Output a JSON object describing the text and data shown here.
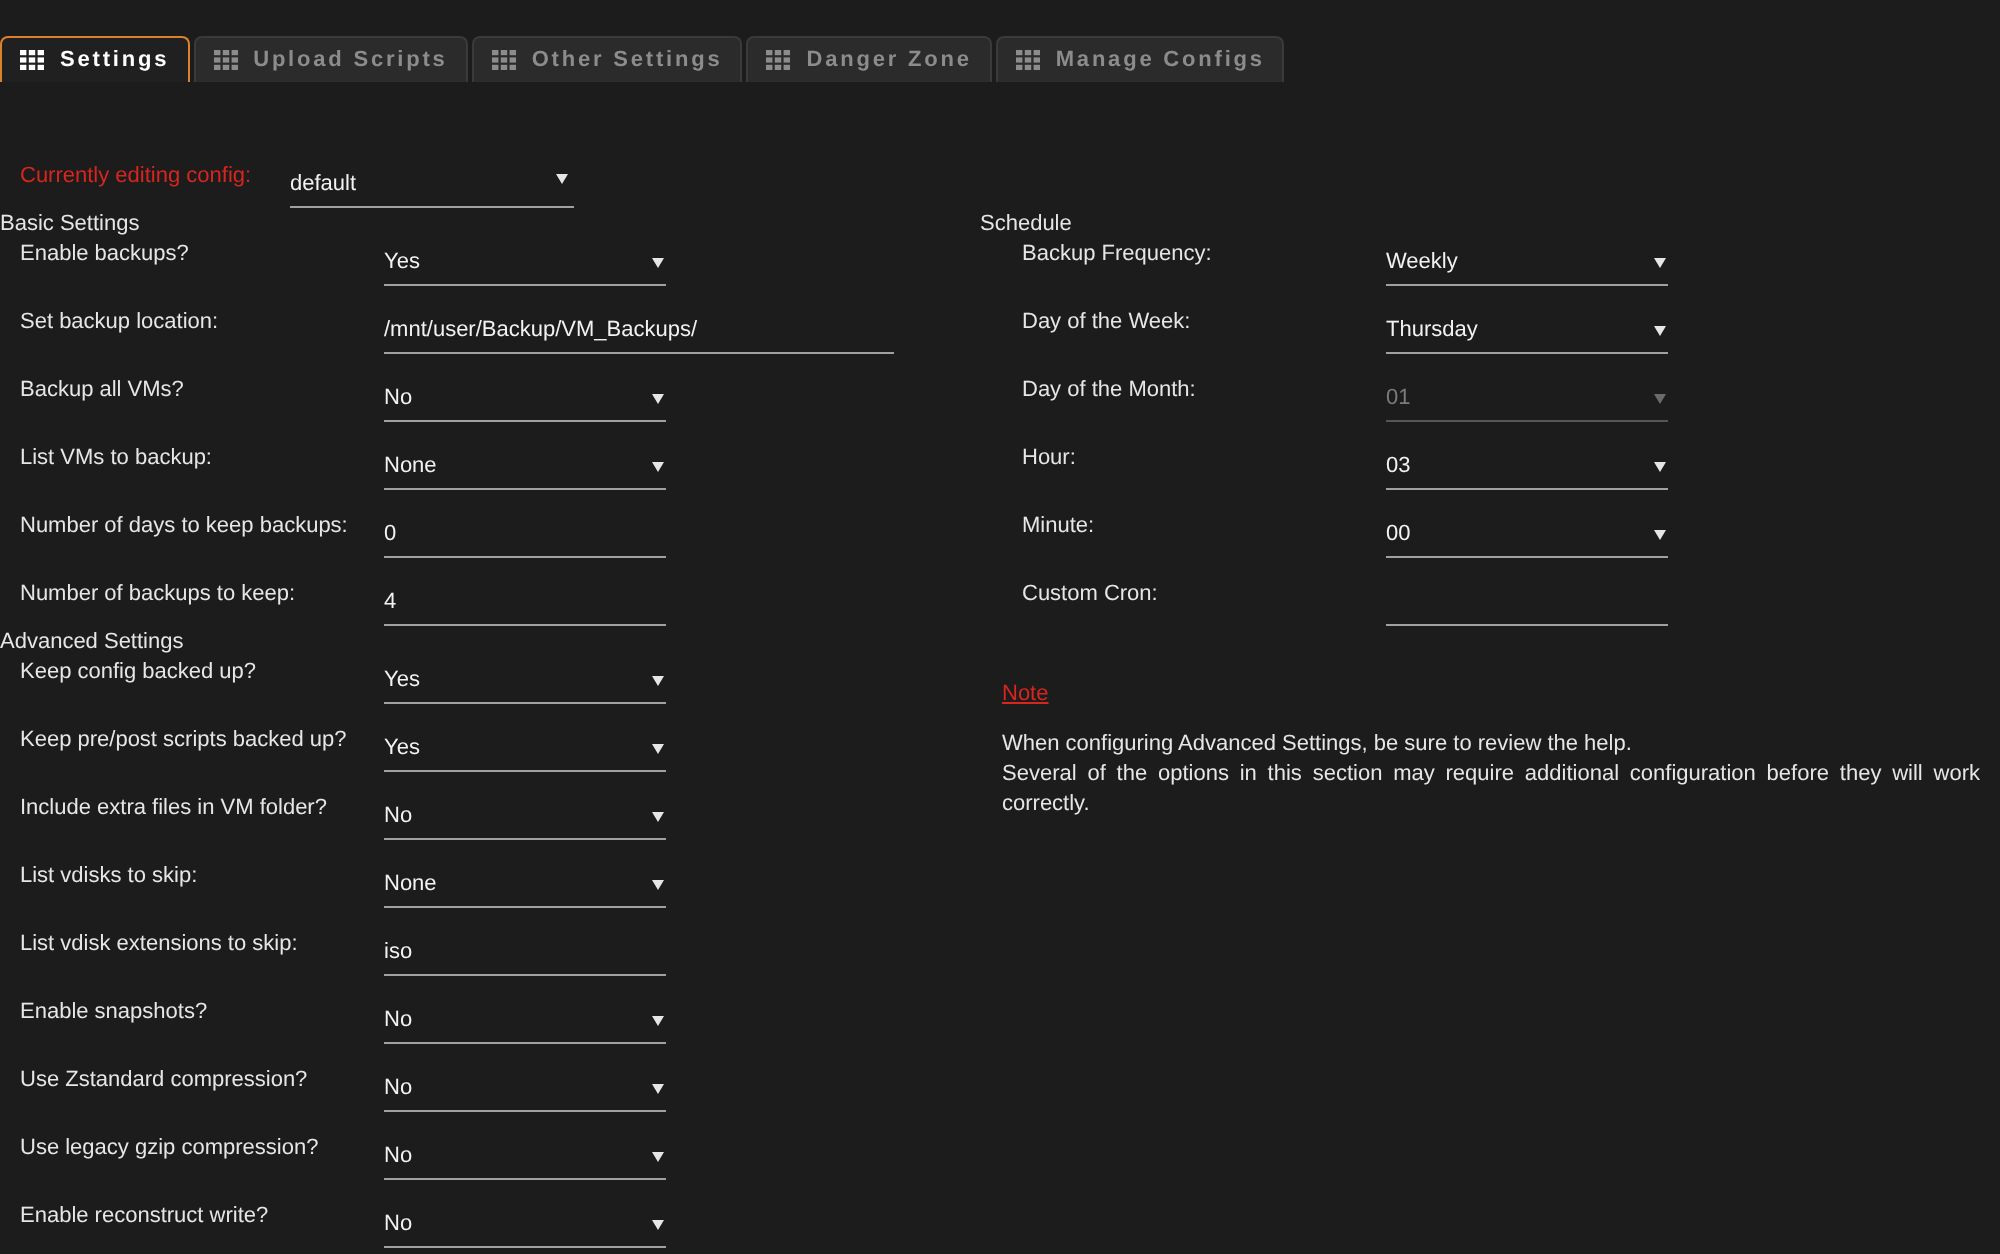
{
  "tabs": [
    {
      "label": "Settings",
      "selected": true
    },
    {
      "label": "Upload Scripts",
      "selected": false
    },
    {
      "label": "Other Settings",
      "selected": false
    },
    {
      "label": "Danger Zone",
      "selected": false
    },
    {
      "label": "Manage Configs",
      "selected": false
    }
  ],
  "config": {
    "label": "Currently editing config:",
    "value": "default"
  },
  "basic_settings": {
    "title": "Basic Settings",
    "fields": [
      {
        "label": "Enable backups?",
        "kind": "select",
        "value": "Yes"
      },
      {
        "label": "Set backup location:",
        "kind": "path",
        "value": "/mnt/user/Backup/VM_Backups/"
      },
      {
        "label": "Backup all VMs?",
        "kind": "select",
        "value": "No"
      },
      {
        "label": "List VMs to backup:",
        "kind": "select",
        "value": "None"
      },
      {
        "label": "Number of days to keep backups:",
        "kind": "text",
        "value": "0"
      },
      {
        "label": "Number of backups to keep:",
        "kind": "text",
        "value": "4"
      }
    ]
  },
  "advanced_settings": {
    "title": "Advanced Settings",
    "fields": [
      {
        "label": "Keep config backed up?",
        "kind": "select",
        "value": "Yes"
      },
      {
        "label": "Keep pre/post scripts backed up?",
        "kind": "select",
        "value": "Yes"
      },
      {
        "label": "Include extra files in VM folder?",
        "kind": "select",
        "value": "No"
      },
      {
        "label": "List vdisks to skip:",
        "kind": "select",
        "value": "None"
      },
      {
        "label": "List vdisk extensions to skip:",
        "kind": "text",
        "value": "iso"
      },
      {
        "label": "Enable snapshots?",
        "kind": "select",
        "value": "No"
      },
      {
        "label": "Use Zstandard compression?",
        "kind": "select",
        "value": "No"
      },
      {
        "label": "Use legacy gzip compression?",
        "kind": "select",
        "value": "No"
      },
      {
        "label": "Enable reconstruct write?",
        "kind": "select",
        "value": "No"
      }
    ]
  },
  "schedule": {
    "title": "Schedule",
    "fields": [
      {
        "label": "Backup Frequency:",
        "kind": "select",
        "value": "Weekly",
        "disabled": false
      },
      {
        "label": "Day of the Week:",
        "kind": "select",
        "value": "Thursday",
        "disabled": false
      },
      {
        "label": "Day of the Month:",
        "kind": "select",
        "value": "01",
        "disabled": true
      },
      {
        "label": "Hour:",
        "kind": "select",
        "value": "03",
        "disabled": false
      },
      {
        "label": "Minute:",
        "kind": "select",
        "value": "00",
        "disabled": false
      },
      {
        "label": "Custom Cron:",
        "kind": "text",
        "disabled": false
      }
    ]
  },
  "note": {
    "title": "Note",
    "lines": [
      "When configuring Advanced Settings, be sure to review the help.",
      "Several of the options in this section may require additional configuration before they will work correctly."
    ]
  }
}
